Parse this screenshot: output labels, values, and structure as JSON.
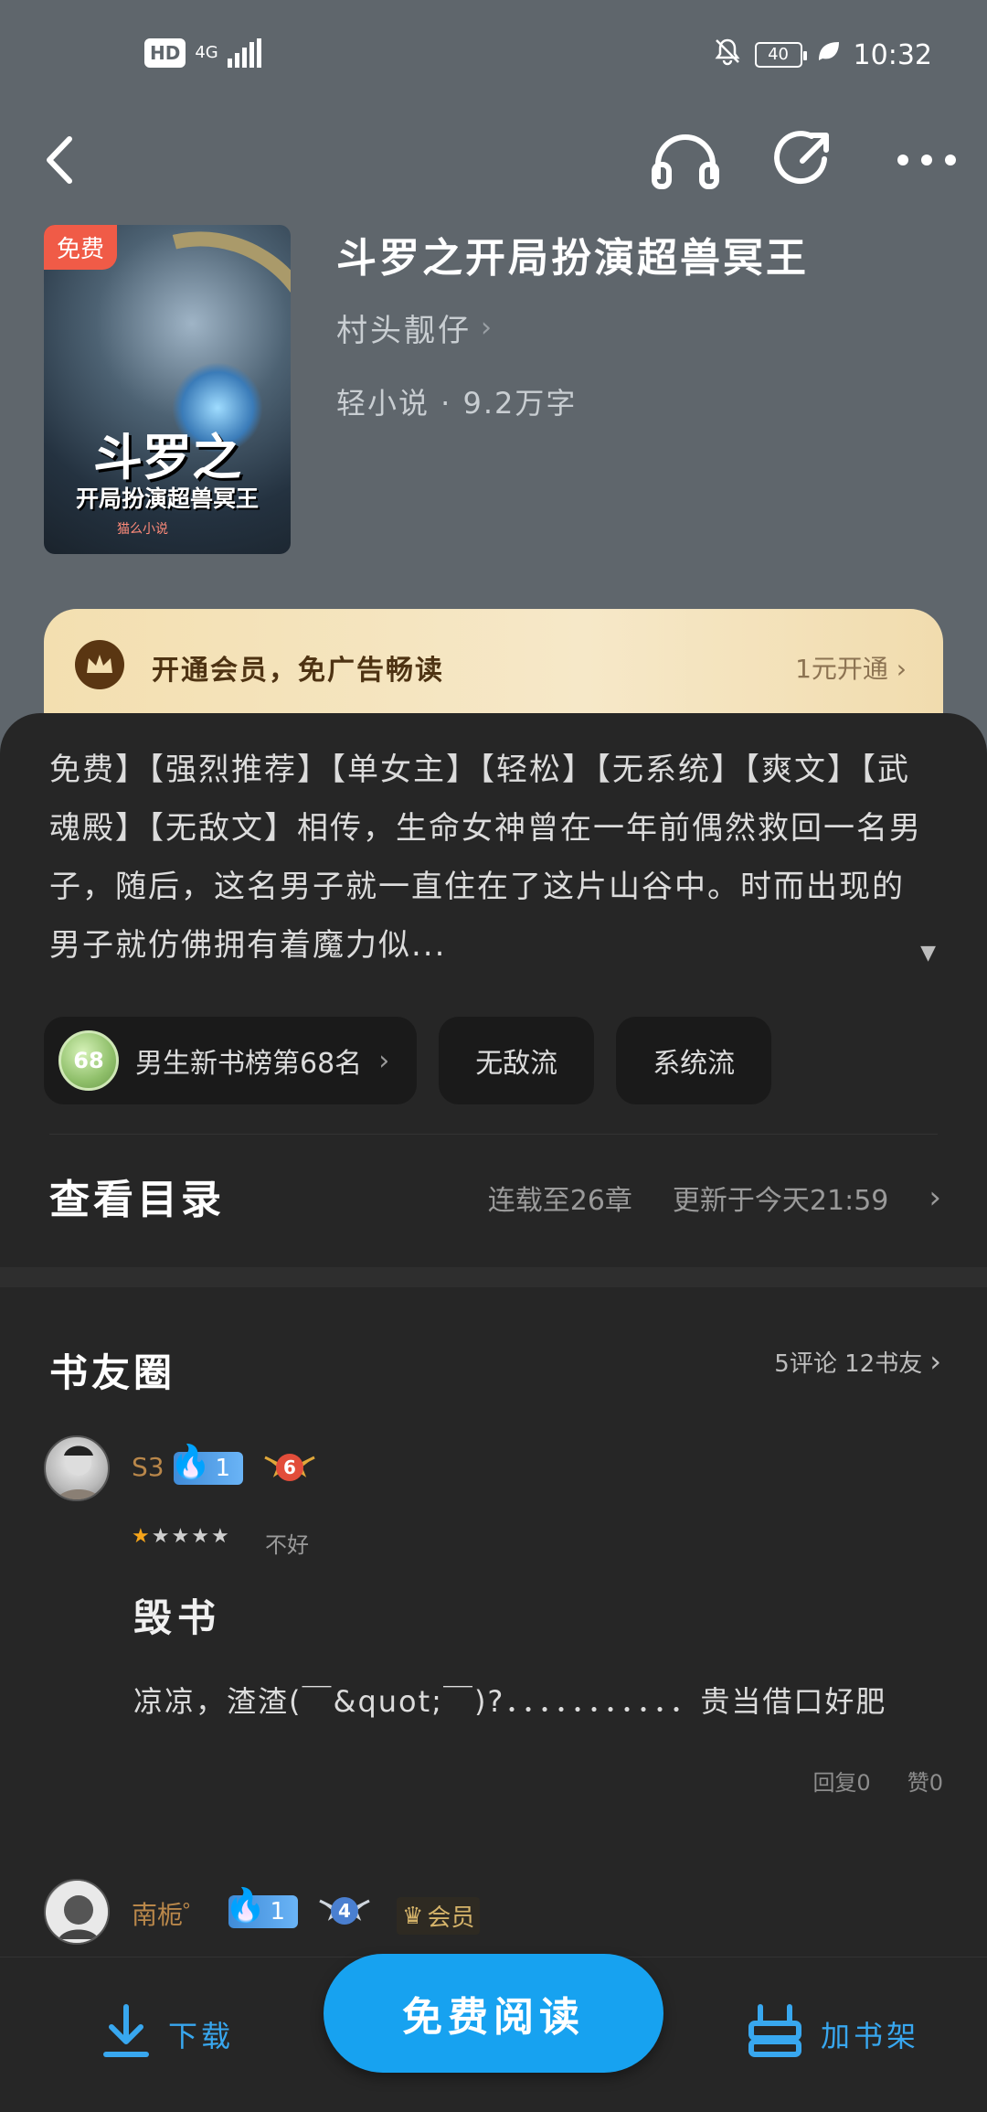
{
  "status_bar": {
    "hd": "HD",
    "network": "4G",
    "battery": "40",
    "time": "10:32"
  },
  "top_nav": {
    "back_icon": "chevron-left-icon",
    "actions": [
      "headphones-icon",
      "share-icon",
      "more-icon"
    ]
  },
  "book": {
    "free_badge": "免费",
    "cover_title_line1": "斗罗之",
    "cover_title_line2": "开局扮演超兽冥王",
    "cover_publisher": "猫么小说",
    "title": "斗罗之开局扮演超兽冥王",
    "author": "村头靓仔",
    "meta": "轻小说 · 9.2万字"
  },
  "vip_banner": {
    "text": "开通会员，免广告畅读",
    "action": "1元开通"
  },
  "synopsis": {
    "text": "免费】【强烈推荐】【单女主】【轻松】【无系统】【爽文】【武魂殿】【无敌文】相传，生命女神曾在一年前偶然救回一名男子，随后，这名男子就一直住在了这片山谷中。时而出现的男子就仿佛拥有着魔力似...",
    "toggle": "▼"
  },
  "tags": {
    "rank_number": "68",
    "rank_label": "男生新书榜第68名",
    "tag1": "无敌流",
    "tag2": "系统流"
  },
  "catalog": {
    "title": "查看目录",
    "chapters": "连载至26章",
    "updated": "更新于今天21:59"
  },
  "book_circle": {
    "title": "书友圈",
    "info": "5评论 12书友"
  },
  "reviews": [
    {
      "user": "S3",
      "fire_level": "1",
      "level": "6",
      "rating": 1,
      "rating_text": "不好",
      "title": "毁书",
      "body": "凉凉，渣渣(￣&quot;￣)?．．．．．．．．．．．贵当借口好肥",
      "reply": "回复0",
      "like": "赞0"
    },
    {
      "user": "南栀゜",
      "fire_level": "1",
      "level": "4",
      "vip": "会员"
    }
  ],
  "bottom_bar": {
    "download": "下载",
    "read": "免费阅读",
    "add_shelf": "加书架"
  },
  "colors": {
    "accent": "#17a2f0",
    "sheet": "#262626",
    "header_bg": "#5f666c",
    "vip_gold": "#f3dfb0",
    "star": "#f6a51a"
  }
}
